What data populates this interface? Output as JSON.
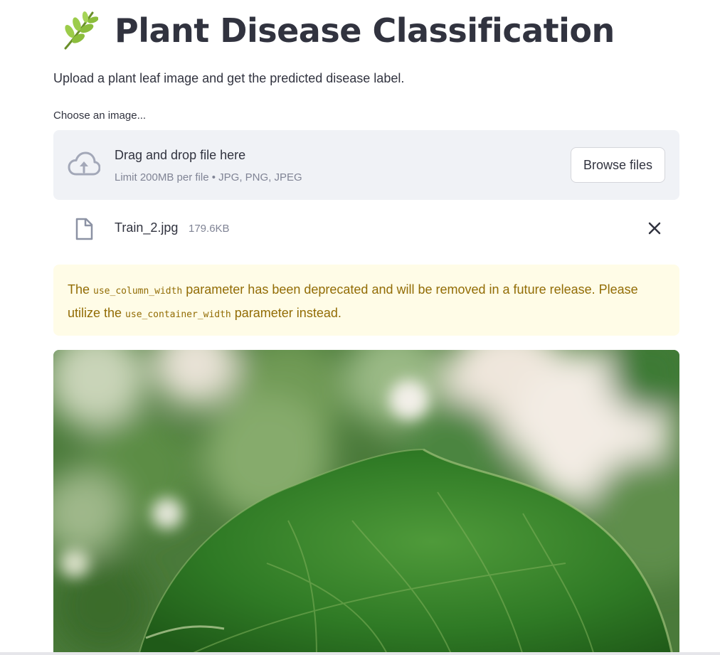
{
  "header": {
    "title": "Plant Disease Classification",
    "emoji_icon": "herb-icon",
    "subtitle": "Upload a plant leaf image and get the predicted disease label."
  },
  "uploader": {
    "label": "Choose an image...",
    "drop_text": "Drag and drop file here",
    "limit_text": "Limit 200MB per file • JPG, PNG, JPEG",
    "browse_label": "Browse files"
  },
  "uploaded_file": {
    "name": "Train_2.jpg",
    "size": "179.6KB"
  },
  "warning": {
    "part1": "The ",
    "code1": "use_column_width",
    "part2": " parameter has been deprecated and will be removed in a future release. Please utilize the ",
    "code2": "use_container_width",
    "part3": " parameter instead."
  },
  "image": {
    "subject": "green-leaf-photo"
  },
  "colors": {
    "text": "#31333f",
    "muted": "#808495",
    "dropzone_bg": "#f0f2f6",
    "warning_bg": "#fffce7",
    "warning_text": "#926c05"
  }
}
